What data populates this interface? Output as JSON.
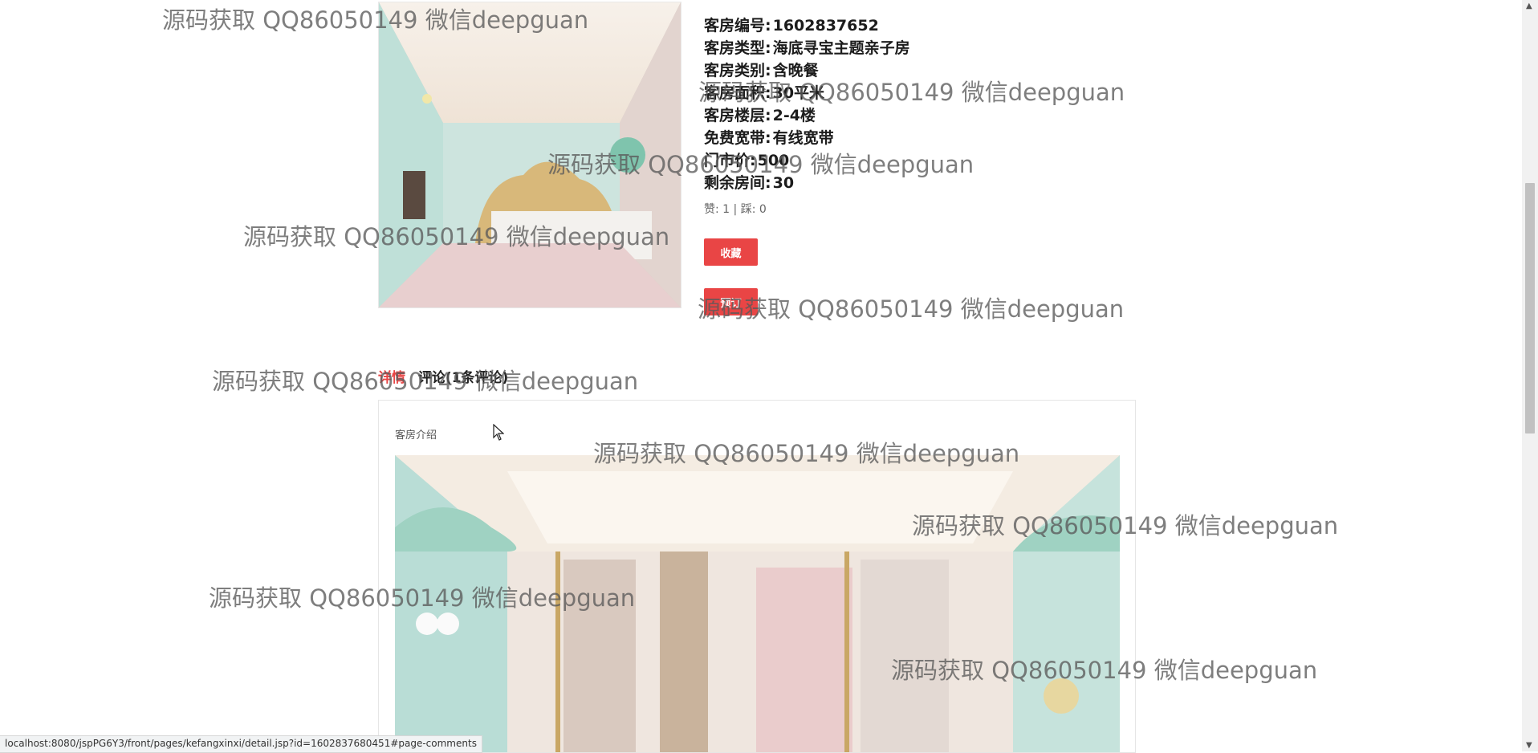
{
  "room": {
    "fields": [
      {
        "label": "客房编号:",
        "value": "1602837652"
      },
      {
        "label": "客房类型:",
        "value": "海底寻宝主题亲子房"
      },
      {
        "label": "客房类别:",
        "value": "含晚餐"
      },
      {
        "label": "客房面积:",
        "value": "30平米"
      },
      {
        "label": "客房楼层:",
        "value": "2-4楼"
      },
      {
        "label": "免费宽带:",
        "value": "有线宽带"
      },
      {
        "label": "门市价:",
        "value": "500"
      },
      {
        "label": "剩余房间:",
        "value": "30"
      }
    ],
    "likes": "赞: 1 | 踩: 0"
  },
  "buttons": {
    "favorite": "收藏",
    "book": "预订"
  },
  "tabs": {
    "detail": "详情",
    "comments": "评论(1条评论)"
  },
  "panel": {
    "title": "客房介绍"
  },
  "statusbar": {
    "url": "localhost:8080/jspPG6Y3/front/pages/kefangxinxi/detail.jsp?id=1602837680451#page-comments"
  },
  "watermark": {
    "text": "源码获取 QQ86050149 微信deepguan"
  },
  "colors": {
    "accent": "#e94545"
  }
}
